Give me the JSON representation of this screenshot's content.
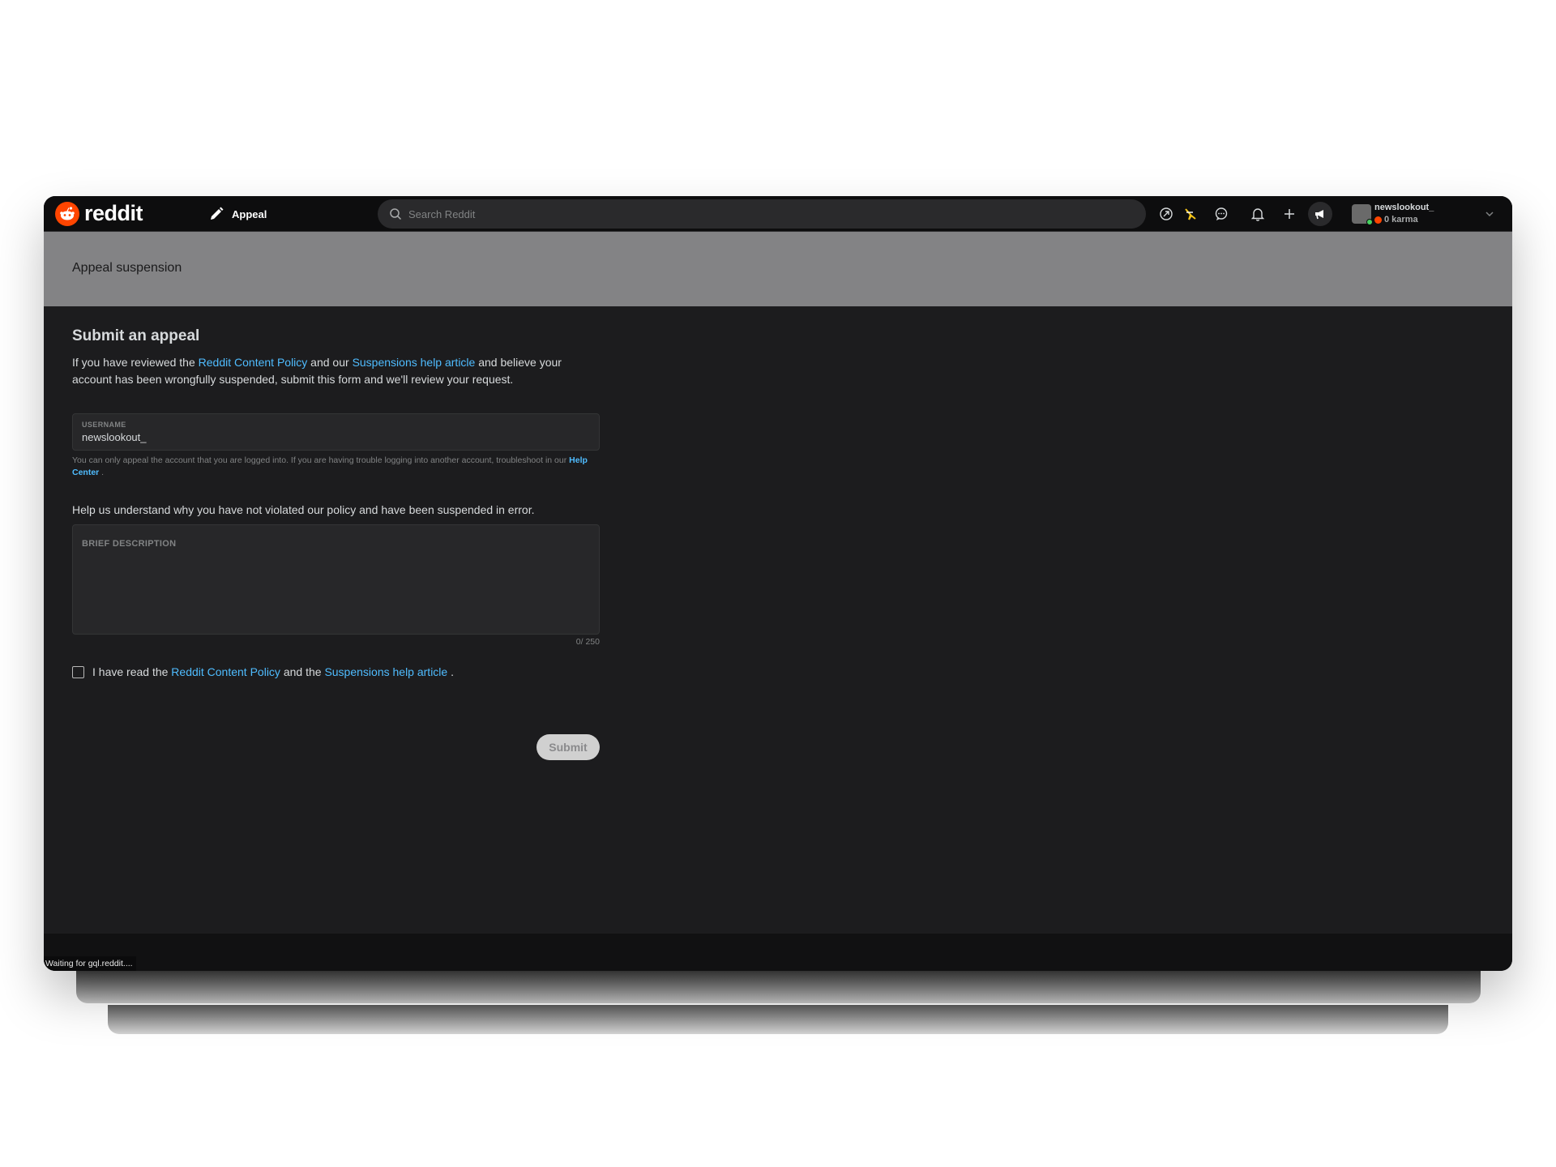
{
  "topbar": {
    "brand": "reddit",
    "page_label": "Appeal",
    "search_placeholder": "Search Reddit"
  },
  "user": {
    "name": "newslookout_",
    "karma": "0 karma"
  },
  "banner": {
    "title": "Appeal suspension"
  },
  "form": {
    "heading": "Submit an appeal",
    "intro": {
      "part1": "If you have reviewed the ",
      "link1": "Reddit Content Policy",
      "part2": " and our ",
      "link2": "Suspensions help article",
      "part3": " and believe your account has been wrongfully suspended, submit this form and we'll review your request."
    },
    "username_label": "USERNAME",
    "username_value": "newslookout_",
    "hint": {
      "text": "You can only appeal the account that you are logged into. If you are having trouble logging into another account, troubleshoot in our ",
      "link": "Help Center",
      "end": " ."
    },
    "question": "Help us understand why you have not violated our policy and have been suspended in error.",
    "description_label": "BRIEF DESCRIPTION",
    "counter": "0/ 250",
    "agree": {
      "part1": "I have read the ",
      "link1": "Reddit Content Policy",
      "part2": " and the ",
      "link2": "Suspensions help article",
      "part3": " ."
    },
    "submit_label": "Submit"
  },
  "status_bar": "Waiting for gql.reddit....",
  "colors": {
    "brand": "#ff4500",
    "link": "#4fbcff",
    "banner": "#838385",
    "background": "#1c1c1e"
  },
  "icons": [
    "reddit-logo-icon",
    "pencil-icon",
    "chevron-down-icon",
    "search-icon",
    "popular-icon",
    "award-icon",
    "chat-icon",
    "notification-bell-icon",
    "plus-icon",
    "advertise-megaphone-icon",
    "avatar"
  ]
}
